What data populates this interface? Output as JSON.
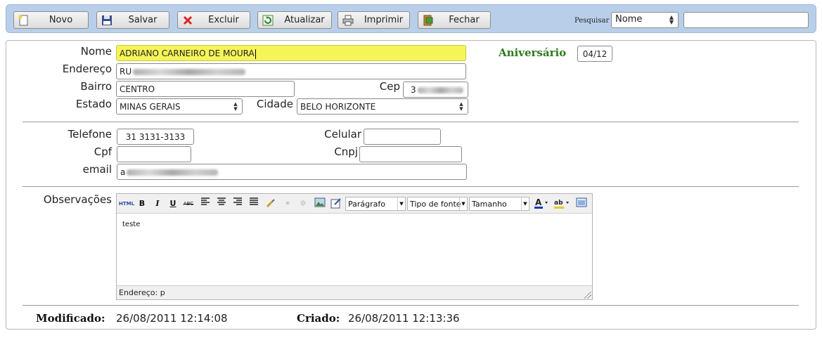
{
  "toolbar": {
    "buttons": [
      {
        "label": "Novo",
        "icon": "new-document-icon"
      },
      {
        "label": "Salvar",
        "icon": "floppy-disk-icon"
      },
      {
        "label": "Excluir",
        "icon": "red-x-icon"
      },
      {
        "label": "Atualizar",
        "icon": "refresh-icon"
      },
      {
        "label": "Imprimir",
        "icon": "printer-icon"
      },
      {
        "label": "Fechar",
        "icon": "exit-door-icon"
      }
    ],
    "search_label": "Pesquisar",
    "search_field_value": "Nome",
    "search_value": ""
  },
  "form": {
    "nome_label": "Nome",
    "nome_value": "ADRIANO CARNEIRO DE MOURA",
    "aniversario_label": "Aniversário",
    "aniversario_value": "04/12",
    "endereco_label": "Endereço",
    "endereco_value": "RU",
    "bairro_label": "Bairro",
    "bairro_value": "CENTRO",
    "cep_label": "Cep",
    "cep_value": "3",
    "estado_label": "Estado",
    "estado_value": "MINAS GERAIS",
    "cidade_label": "Cidade",
    "cidade_value": "BELO HORIZONTE",
    "telefone_label": "Telefone",
    "telefone_value": "31 3131-3133",
    "celular_label": "Celular",
    "celular_value": "",
    "cpf_label": "Cpf",
    "cpf_value": "",
    "cnpj_label": "Cnpj",
    "cnpj_value": "",
    "email_label": "email",
    "email_value": "a"
  },
  "editor": {
    "label": "Observações",
    "html_button": "HTML",
    "paragraph_select": "Parágrafo",
    "font_select": "Tipo de fonte",
    "size_select": "Tamanho",
    "content": "teste",
    "status": "Endereço: p"
  },
  "footer": {
    "modificado_label": "Modificado:",
    "modificado_value": "26/08/2011 12:14:08",
    "criado_label": "Criado:",
    "criado_value": "26/08/2011 12:13:36"
  },
  "colors": {
    "toolbar_bg": "#b9cfe9",
    "highlight_field": "#f5f55a",
    "aniversario_green": "#2d7a1e"
  }
}
